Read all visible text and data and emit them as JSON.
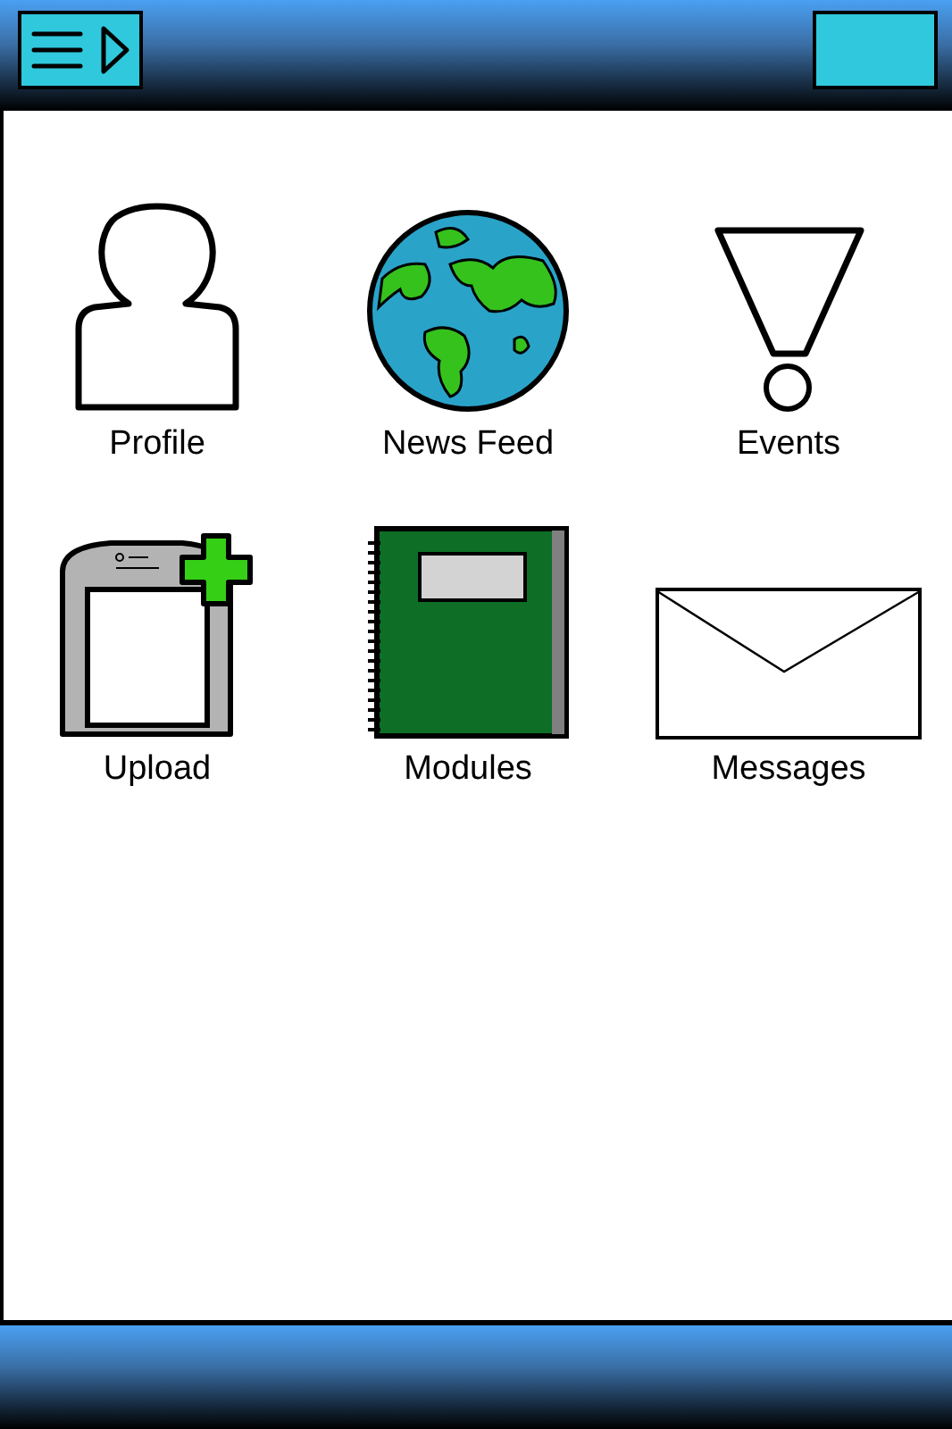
{
  "tiles": [
    {
      "kind": "person",
      "label": "Profile"
    },
    {
      "kind": "globe",
      "label": "News Feed"
    },
    {
      "kind": "exclamation",
      "label": "Events"
    },
    {
      "kind": "tablet-plus",
      "label": "Upload"
    },
    {
      "kind": "notebook",
      "label": "Modules"
    },
    {
      "kind": "envelope",
      "label": "Messages"
    }
  ]
}
